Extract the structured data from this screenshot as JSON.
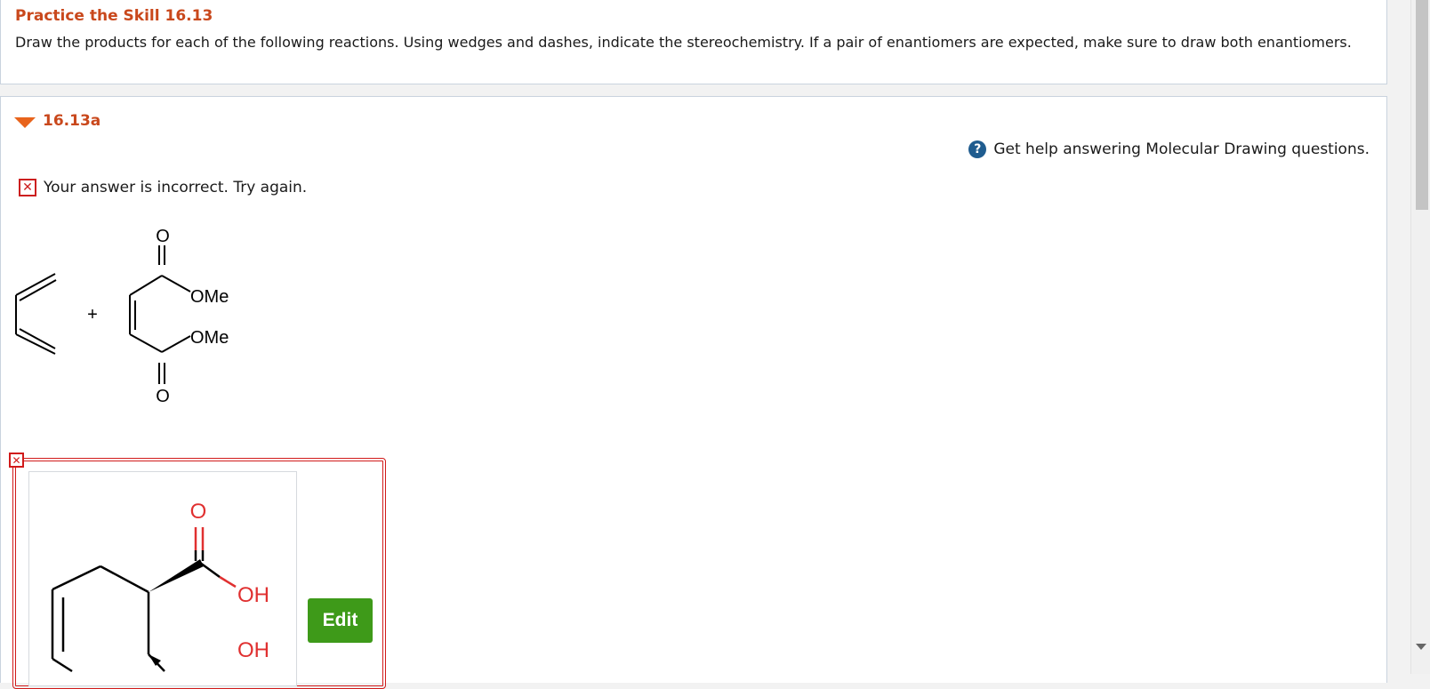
{
  "header": {
    "title": "Practice the Skill 16.13",
    "instructions": "Draw the products for each of the following reactions. Using wedges and dashes, indicate the stereochemistry. If a pair of enantiomers are expected, make sure to draw both enantiomers."
  },
  "part": {
    "label": "16.13a",
    "expanded": true
  },
  "help": {
    "icon": "question-icon",
    "text": "Get help answering Molecular Drawing questions."
  },
  "feedback": {
    "icon": "x-icon",
    "text": "Your answer is incorrect.  Try again."
  },
  "reaction": {
    "plus": "+",
    "labels": [
      "O",
      "OMe",
      "OMe",
      "O"
    ]
  },
  "answer": {
    "labels": [
      "O",
      "OH",
      "OH"
    ],
    "edit_label": "Edit"
  },
  "colors": {
    "title": "#c9481c",
    "error": "#d11a1a",
    "edit_button": "#3e9a19",
    "help_icon": "#1f5c8f"
  }
}
